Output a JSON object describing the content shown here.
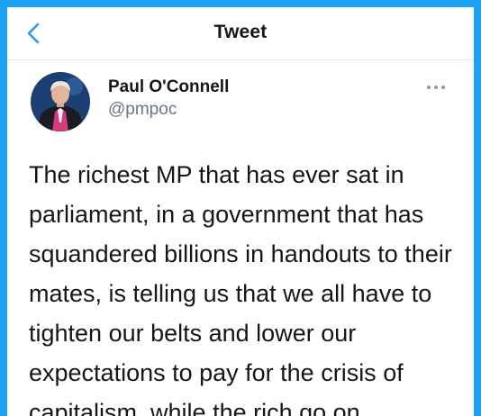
{
  "header": {
    "title": "Tweet",
    "back_icon": "chevron-left-icon",
    "accent_color": "#1da1f2"
  },
  "tweet": {
    "author": {
      "name": "Paul O'Connell",
      "handle": "@pmpoc",
      "avatar_icon": "profile-photo"
    },
    "more_icon": "ellipsis-icon",
    "text": "The richest MP that has ever sat in parliament, in a government that has squandered billions in handouts to their mates, is telling us that we all have to tighten our belts and lower our expectations to pay for the crisis of capitalism, while the rich go on"
  }
}
